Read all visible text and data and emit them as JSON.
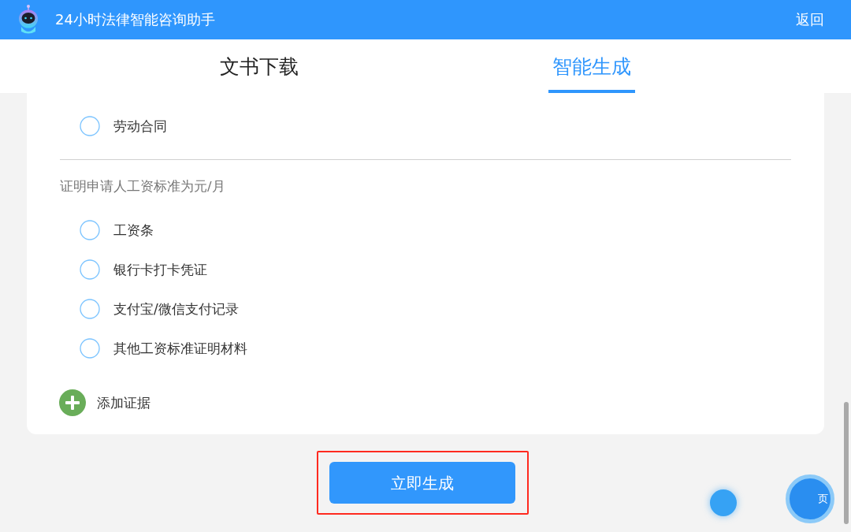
{
  "header": {
    "title": "24小时法律智能咨询助手",
    "back": "返回"
  },
  "tabs": [
    {
      "label": "文书下载",
      "selected": false
    },
    {
      "label": "智能生成",
      "selected": true
    }
  ],
  "form": {
    "groups": [
      {
        "options": [
          {
            "label": "劳动合同",
            "checked": false
          }
        ]
      },
      {
        "label": "证明申请人工资标准为元/月",
        "options": [
          {
            "label": "工资条",
            "checked": false
          },
          {
            "label": "银行卡打卡凭证",
            "checked": false
          },
          {
            "label": "支付宝/微信支付记录",
            "checked": false
          },
          {
            "label": "其他工资标准证明材料",
            "checked": false
          }
        ]
      }
    ],
    "add_evidence": "添加证据"
  },
  "generate_button": {
    "label": "立即生成",
    "highlighted": true
  },
  "floating_buttons": [
    {
      "kind": "plain"
    },
    {
      "kind": "labeled",
      "label": "页"
    }
  ]
}
